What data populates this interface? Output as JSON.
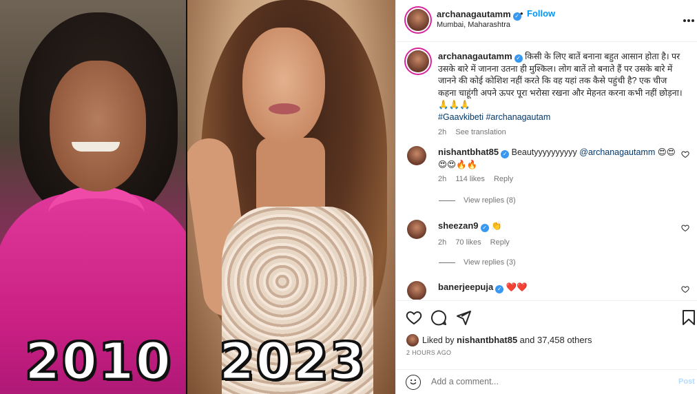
{
  "media": {
    "year_left": "2010",
    "year_right": "2023"
  },
  "header": {
    "username": "archanagautamm",
    "dot": "•",
    "follow": "Follow",
    "location": "Mumbai, Maharashtra",
    "more": "•••"
  },
  "caption": {
    "username": "archanagautamm",
    "text": "किसी के लिए बातें बनाना बहुत आसान होता है। पर उसके बारे में जानना उतना ही मुश्किल। लोग बातें तो बनाते हैं पर उसके बारे में जानने की कोई कोशिश नहीं करते कि वह यहां तक कैसे पहुंची है? एक चीज कहना चाहूंगी अपने ऊपर पूरा भरोसा रखना और मेहनत करना कभी नहीं छोड़ना। 🙏🙏🙏",
    "hashtags": "#Gaavkibeti #archanagautam",
    "time": "2h",
    "see_translation": "See translation"
  },
  "comments": [
    {
      "username": "nishantbhat85",
      "text": "Beautyyyyyyyyyy",
      "mention": "@archanagautamm",
      "emoji": "😍😍 😍😍🔥🔥",
      "time": "2h",
      "likes": "114 likes",
      "reply": "Reply",
      "view_replies": "View replies (8)"
    },
    {
      "username": "sheezan9",
      "text": "👏",
      "time": "2h",
      "likes": "70 likes",
      "reply": "Reply",
      "view_replies": "View replies (3)"
    },
    {
      "username": "banerjeepuja",
      "text": "❤️❤️"
    }
  ],
  "actions": {
    "liked_by_prefix": "Liked by",
    "liked_by_user": "nishantbhat85",
    "liked_by_suffix": "and 37,458 others",
    "time_ago": "2 HOURS AGO"
  },
  "add_comment": {
    "placeholder": "Add a comment...",
    "post": "Post"
  },
  "colors": {
    "accent": "#0095f6",
    "verified": "#3897f0",
    "hashtag": "#00376b"
  }
}
